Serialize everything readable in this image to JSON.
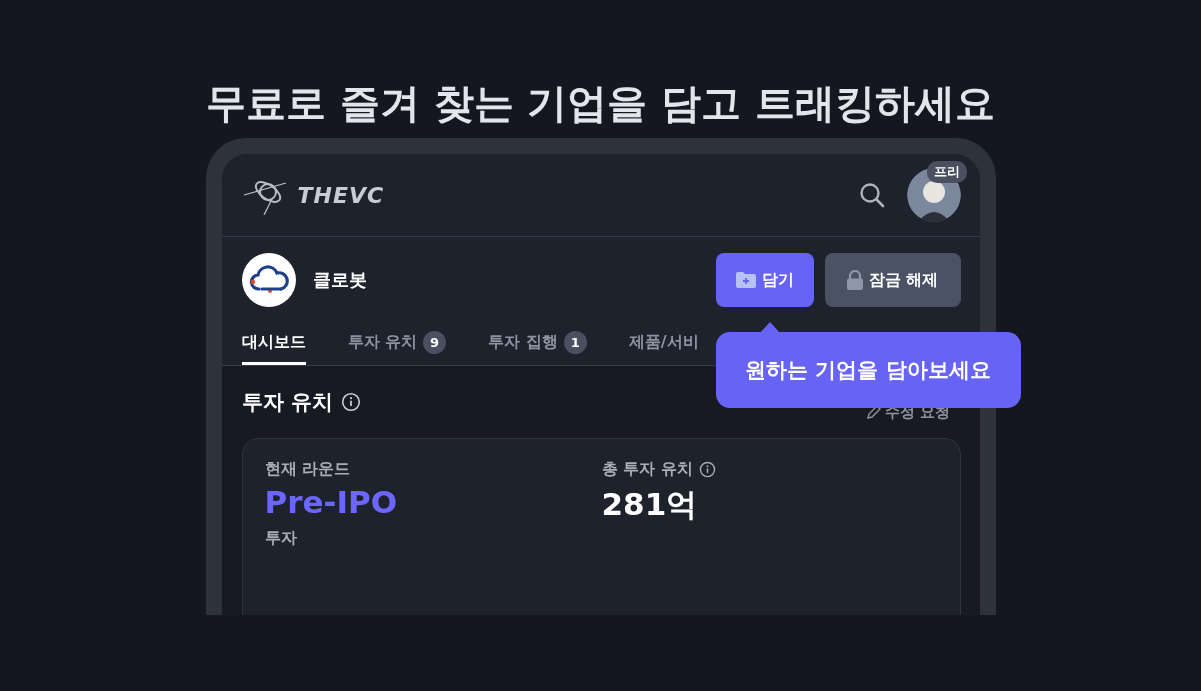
{
  "headline": "무료로 즐겨 찾는 기업을 담고 트래킹하세요",
  "app": {
    "logo": "THEVC",
    "plan_badge": "프리"
  },
  "company": {
    "name": "클로봇",
    "buttons": [
      {
        "label": "담기",
        "kind": "primary"
      },
      {
        "label": "잠금 해제",
        "kind": "secondary"
      }
    ]
  },
  "tabs": [
    {
      "label": "대시보드",
      "selected": true
    },
    {
      "label": "투자 유치",
      "count": "9",
      "selected": false
    },
    {
      "label": "투자 집행",
      "count": "1",
      "selected": false
    },
    {
      "label": "제품/서비",
      "selected": false
    }
  ],
  "tooltip": "원하는 기업을 담아보세요",
  "section": {
    "title": "투자 유치",
    "action": "수정 요청"
  },
  "card": {
    "stats": [
      {
        "label": "현재 라운드",
        "value": "Pre-IPO",
        "sub": "투자",
        "kind": "round"
      },
      {
        "label": "총 투자 유치",
        "value": "281억",
        "kind": "total"
      }
    ]
  }
}
